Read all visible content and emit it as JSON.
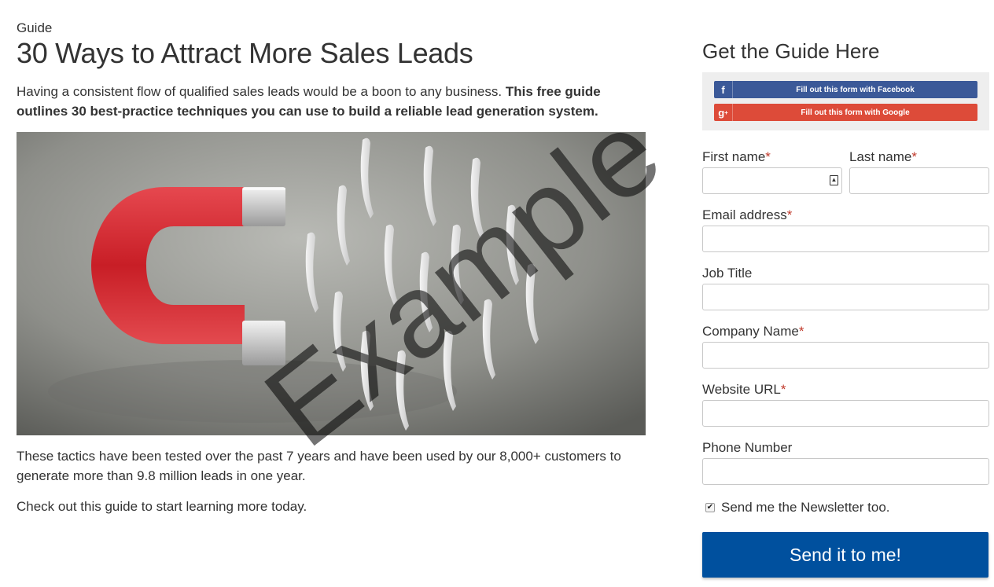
{
  "guide": {
    "eyebrow": "Guide",
    "title": "30 Ways to Attract More Sales Leads",
    "intro_plain": "Having a consistent flow of qualified sales leads would be a boon to any business. ",
    "intro_bold": "This free guide outlines 30 best-practice techniques you can use to build a reliable lead generation system.",
    "paragraph1": "These tactics have been tested over the past 7 years and have been used by our 8,000+ customers to generate more than 9.8 million leads in one year.",
    "paragraph2": "Check out this guide to start learning more today."
  },
  "form": {
    "title": "Get the Guide Here",
    "facebook_label": "Fill out this form with Facebook",
    "google_label": "Fill out this form with Google",
    "required_marker": "*",
    "first_name_label": "First name",
    "last_name_label": "Last name",
    "email_label": "Email address",
    "job_title_label": "Job Title",
    "company_label": "Company Name",
    "website_label": "Website URL",
    "phone_label": "Phone Number",
    "newsletter_label": "Send me the Newsletter too.",
    "newsletter_checked": true,
    "submit_label": "Send it to me!"
  },
  "watermark_text": "Example",
  "colors": {
    "facebook": "#3b5998",
    "google": "#dd4b39",
    "submit": "#00509e",
    "required": "#c0392b"
  }
}
